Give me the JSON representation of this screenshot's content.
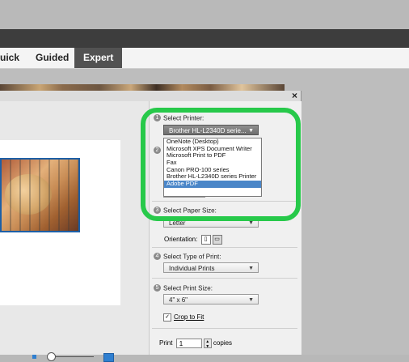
{
  "modes": {
    "quick": "uick",
    "guided": "Guided",
    "expert": "Expert"
  },
  "dialog": {
    "close": "×"
  },
  "printer": {
    "step": "1",
    "label": "Select Printer:",
    "value": "Brother HL-L2340D serie...",
    "options": [
      "OneNote (Desktop)",
      "Microsoft XPS Document Writer",
      "Microsoft Print to PDF",
      "Fax",
      "Canon PRO-100 series",
      "Brother HL-L2340D series Printer",
      "Adobe PDF"
    ],
    "highlighted_option": "Adobe PDF"
  },
  "step2": {
    "step": "2"
  },
  "paper": {
    "step": "3",
    "label": "Select Paper Size:",
    "value": "Letter",
    "orientation_label": "Orientation:"
  },
  "print_type": {
    "step": "4",
    "label": "Select Type of Print:",
    "value": "Individual Prints"
  },
  "print_size": {
    "step": "5",
    "label": "Select Print Size:",
    "value": "4\" x 6\""
  },
  "crop": {
    "label": "Crop to Fit",
    "checked": true
  },
  "copies": {
    "prefix": "Print",
    "value": "1",
    "suffix": "copies"
  },
  "colors": {
    "highlight": "#27c94a",
    "selection": "#4a86c8",
    "accent": "#2f7fd0"
  }
}
